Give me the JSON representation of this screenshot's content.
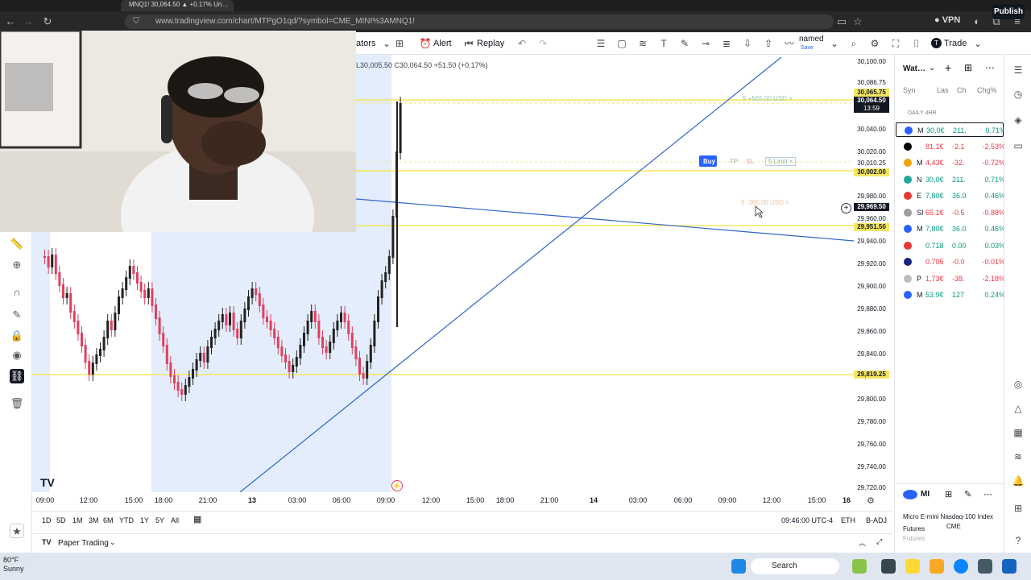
{
  "browser": {
    "tab_title": "MNQ1! 30,064.50 ▲ +0.17% Un…",
    "url": "www.tradingview.com/chart/MTPgO1qd/?symbol=CME_MINI%3AMNQ1!",
    "vpn": "VPN"
  },
  "toolbar": {
    "indicators_fragment": "ators",
    "alert": "Alert",
    "replay": "Replay",
    "layout_name": "named",
    "save": "Save",
    "trade": "Trade",
    "publish": "Publish"
  },
  "ohlc": "L30,005.50  C30,064.50  +51.50 (+0.17%)",
  "chart": {
    "price_labels": [
      "30,100.00",
      "30,086.75",
      "30,040.00",
      "30,020.00",
      "30,010.25",
      "29,980.00",
      "29,960.00",
      "29,940.00",
      "29,920.00",
      "29,900.00",
      "29,880.00",
      "29,860.00",
      "29,840.00",
      "29,820.00",
      "29,800.00",
      "29,780.00",
      "29,760.00",
      "29,740.00",
      "29,720.00"
    ],
    "tag_current_price": "30,064.50",
    "tag_current_time": "13:59",
    "tag_upper": "30,065.75",
    "tag_buy_level": "30,002.00",
    "tag_crosshair": "29,969.50",
    "tag_mid": "29,951.50",
    "tag_low": "29,819.25",
    "order_top": "5    +565.00 USD    ×",
    "order_buy": "Buy",
    "order_tp": "TP",
    "order_sl": "SL",
    "order_limit": "5    Limit    ×",
    "order_lower": "5    -365.00 USD    ×",
    "time_labels": [
      "09:00",
      "12:00",
      "15:00",
      "18:00",
      "21:00",
      "13",
      "03:00",
      "06:00",
      "09:00",
      "12:00",
      "15:00",
      "18:00",
      "21:00",
      "14",
      "03:00",
      "06:00",
      "09:00",
      "12:00",
      "15:00",
      "16"
    ]
  },
  "bottom": {
    "ranges": [
      "1D",
      "5D",
      "1M",
      "3M",
      "6M",
      "YTD",
      "1Y",
      "5Y",
      "All"
    ],
    "clock": "09:46:00 UTC-4",
    "session": "ETH",
    "adj": "B-ADJ",
    "paper_trading": "Paper Trading"
  },
  "watchlist": {
    "title": "Wat…",
    "columns": [
      "Syn",
      "Las",
      "Ch",
      "Chg%"
    ],
    "section": "DAILY 4HR",
    "rows": [
      {
        "sym": "M",
        "last": "30,0€",
        "chg": "211.",
        "pct": "0.71%",
        "color": "#2962ff",
        "up": true
      },
      {
        "sym": "",
        "last": "81.1€",
        "chg": "-2.1",
        "pct": "-2.53%",
        "color": "#000000",
        "up": false
      },
      {
        "sym": "M",
        "last": "4,43€",
        "chg": "-32.",
        "pct": "-0.72%",
        "color": "#f0a30a",
        "up": false
      },
      {
        "sym": "N",
        "last": "30,0€",
        "chg": "211.",
        "pct": "0.71%",
        "color": "#26a69a",
        "up": true
      },
      {
        "sym": "E",
        "last": "7,80€",
        "chg": "36.0",
        "pct": "0.46%",
        "color": "#e53935",
        "up": true
      },
      {
        "sym": "SI",
        "last": "65.1€",
        "chg": "-0.5",
        "pct": "-0.88%",
        "color": "#9e9e9e",
        "up": false
      },
      {
        "sym": "M",
        "last": "7,80€",
        "chg": "36.0",
        "pct": "0.46%",
        "color": "#2962ff",
        "up": true
      },
      {
        "sym": "",
        "last": "0.718",
        "chg": "0.00",
        "pct": "0.03%",
        "color": "#e53935",
        "up": true
      },
      {
        "sym": "",
        "last": "0.705",
        "chg": "-0.0",
        "pct": "-0.01%",
        "color": "#1a237e",
        "up": false
      },
      {
        "sym": "P",
        "last": "1,73€",
        "chg": "-38.",
        "pct": "-2.18%",
        "color": "#bdbdbd",
        "up": false
      },
      {
        "sym": "M",
        "last": "53.9€",
        "chg": "127",
        "pct": "0.24%",
        "color": "#2962ff",
        "up": true
      }
    ],
    "details_symbol": "MI",
    "details_name": "Micro E-mini Nasdaq-100 Index Futures",
    "details_exchange": "CME",
    "details_type": "Futures"
  },
  "taskbar": {
    "temp": "80°F",
    "weather": "Sunny",
    "search": "Search"
  },
  "colors": {
    "up": "#089981",
    "down": "#f23645",
    "candle_up": "#222222",
    "candle_down": "#e0405f",
    "hline": "#f5e663",
    "trend": "#2f64c9"
  }
}
